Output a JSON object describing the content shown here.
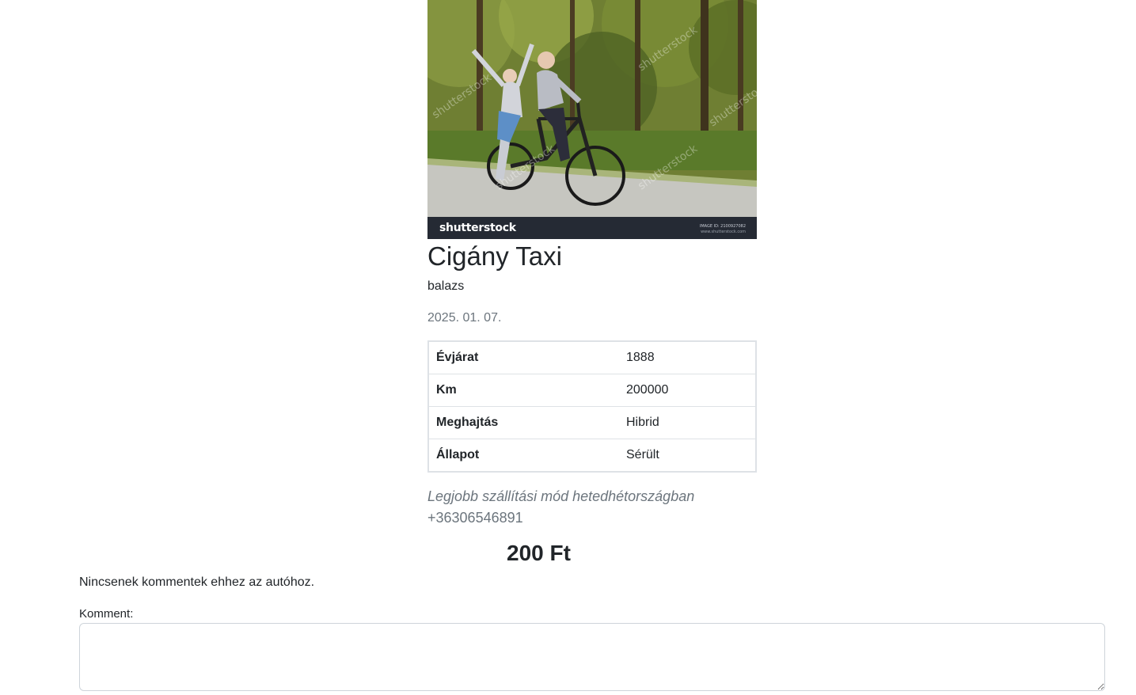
{
  "listing": {
    "photo": {
      "brand": "shutterstock",
      "image_id": "IMAGE ID: 2100927082",
      "site": "www.shutterstock.com"
    },
    "title": "Cigány Taxi",
    "owner": "balazs",
    "date": "2025. 01. 07.",
    "specs": [
      {
        "label": "Évjárat",
        "value": "1888"
      },
      {
        "label": "Km",
        "value": "200000"
      },
      {
        "label": "Meghajtás",
        "value": "Hibrid"
      },
      {
        "label": "Állapot",
        "value": "Sérült"
      }
    ],
    "description": "Legjobb szállítási mód hetedhétországban",
    "phone": "+36306546891",
    "price": "200 Ft"
  },
  "comments": {
    "empty_message": "Nincsenek kommentek ehhez az autóhoz.",
    "label": "Komment:",
    "input_value": ""
  }
}
